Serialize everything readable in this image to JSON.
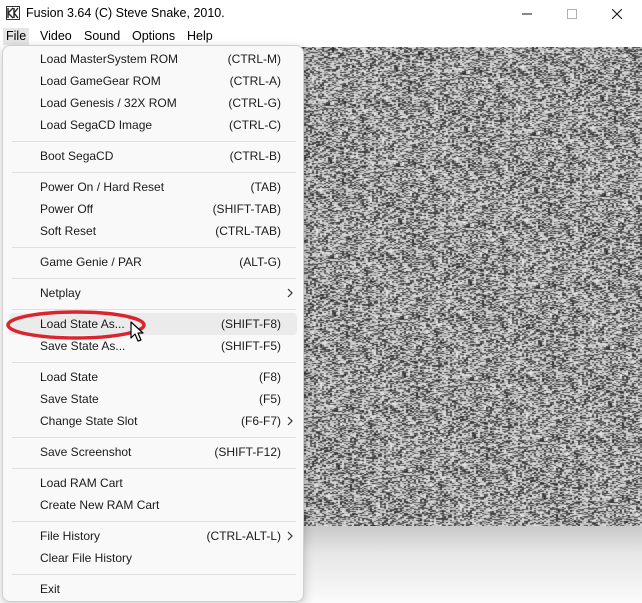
{
  "window": {
    "title": "Fusion 3.64 (C) Steve Snake, 2010.",
    "icons": [
      "app-icon",
      "minimize-icon",
      "maximize-icon",
      "close-icon"
    ]
  },
  "menubar": {
    "items": [
      "File",
      "Video",
      "Sound",
      "Options",
      "Help"
    ],
    "active": "File"
  },
  "file_menu": {
    "items": [
      {
        "label": "Load MasterSystem ROM",
        "shortcut": "(CTRL-M)"
      },
      {
        "label": "Load GameGear ROM",
        "shortcut": "(CTRL-A)"
      },
      {
        "label": "Load Genesis / 32X ROM",
        "shortcut": "(CTRL-G)"
      },
      {
        "label": "Load SegaCD Image",
        "shortcut": "(CTRL-C)"
      },
      {
        "label": "Boot SegaCD",
        "shortcut": "(CTRL-B)"
      },
      {
        "label": "Power On / Hard Reset",
        "shortcut": "(TAB)"
      },
      {
        "label": "Power Off",
        "shortcut": "(SHIFT-TAB)"
      },
      {
        "label": "Soft Reset",
        "shortcut": "(CTRL-TAB)"
      },
      {
        "label": "Game Genie / PAR",
        "shortcut": "(ALT-G)"
      },
      {
        "label": "Netplay",
        "shortcut": "",
        "submenu": true
      },
      {
        "label": "Load State As...",
        "shortcut": "(SHIFT-F8)",
        "highlighted": true
      },
      {
        "label": "Save State As...",
        "shortcut": "(SHIFT-F5)"
      },
      {
        "label": "Load State",
        "shortcut": "(F8)"
      },
      {
        "label": "Save State",
        "shortcut": "(F5)"
      },
      {
        "label": "Change State Slot",
        "shortcut": "(F6-F7)",
        "submenu": true
      },
      {
        "label": "Save Screenshot",
        "shortcut": "(SHIFT-F12)"
      },
      {
        "label": "Load RAM Cart",
        "shortcut": ""
      },
      {
        "label": "Create New RAM Cart",
        "shortcut": ""
      },
      {
        "label": "File History",
        "shortcut": "(CTRL-ALT-L)",
        "submenu": true
      },
      {
        "label": "Clear File History",
        "shortcut": ""
      },
      {
        "label": "Exit",
        "shortcut": ""
      }
    ]
  },
  "annotation": {
    "shape": "ellipse",
    "color": "#d9262e",
    "target": "Load State As..."
  },
  "colors": {
    "menu_bg": "#f9f9f9",
    "highlight": "#ebebeb",
    "separator": "#e0e0e0",
    "annotation": "#d9262e"
  }
}
